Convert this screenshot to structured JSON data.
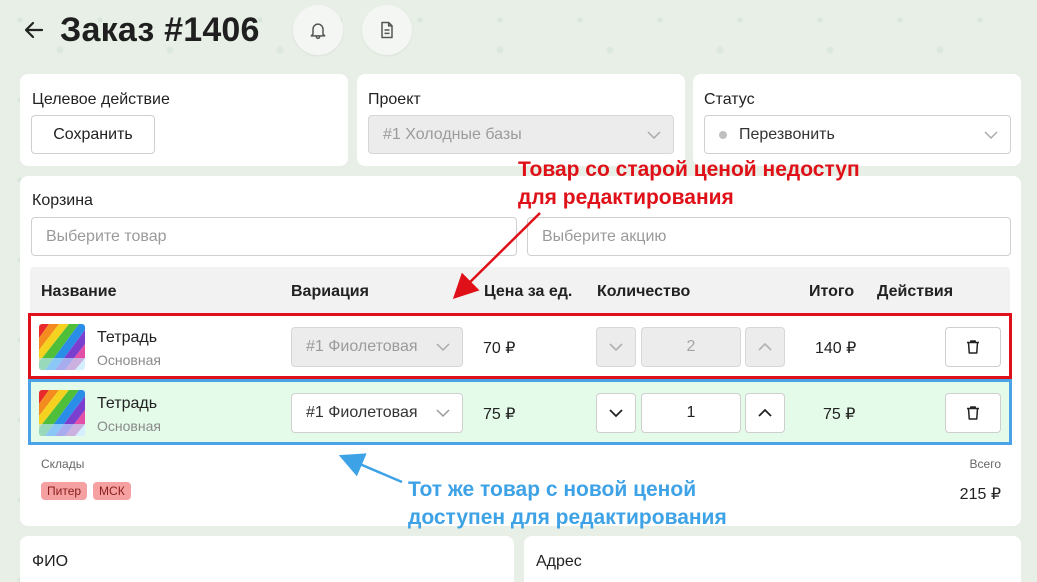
{
  "header": {
    "title": "Заказ #1406"
  },
  "target_card": {
    "label": "Целевое действие",
    "button_label": "Сохранить"
  },
  "project_card": {
    "label": "Проект",
    "select_value": "#1 Холодные базы"
  },
  "status_card": {
    "label": "Статус",
    "select_value": "Перезвонить"
  },
  "cart": {
    "label": "Корзина",
    "product_placeholder": "Выберите товар",
    "promo_placeholder": "Выберите акцию",
    "columns": {
      "name": "Название",
      "variation": "Вариация",
      "price": "Цена за ед.",
      "quantity": "Количество",
      "total": "Итого",
      "actions": "Действия"
    },
    "rows": [
      {
        "name": "Тетрадь",
        "sub": "Основная",
        "variation": "#1 Фиолетовая",
        "price": "70 ₽",
        "quantity": "2",
        "total": "140 ₽",
        "editable": false
      },
      {
        "name": "Тетрадь",
        "sub": "Основная",
        "variation": "#1 Фиолетовая",
        "price": "75 ₽",
        "quantity": "1",
        "total": "75 ₽",
        "editable": true
      }
    ],
    "warehouses_label": "Склады",
    "warehouses": [
      "Питер",
      "МСК"
    ],
    "total_label": "Всего",
    "total_value": "215 ₽"
  },
  "bottom": {
    "fio_label": "ФИО",
    "address_label": "Адрес"
  },
  "annotations": {
    "red_line1": "Товар со старой ценой недоступ",
    "red_line2": "для редактирования",
    "blue_line1": "Тот же товар с новой ценой",
    "blue_line2": "доступен для редактирования"
  },
  "colors": {
    "annotation_red": "#e01018",
    "annotation_blue": "#3ea2e6",
    "new_row_bg": "#e4fbe9",
    "tag_bg": "#f6a1a1",
    "page_bg": "#e7efe6"
  }
}
